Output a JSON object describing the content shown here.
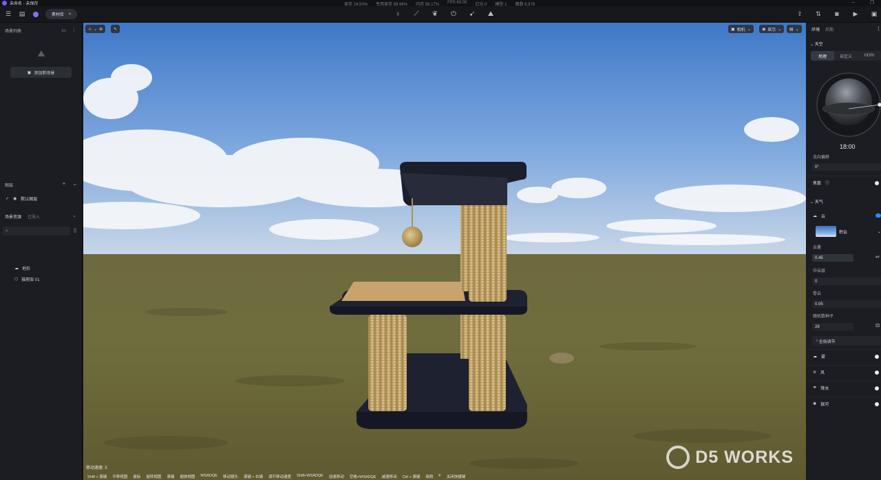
{
  "titlebar": {
    "title": "未命名 - 未保存",
    "stats": [
      "显存 24.50%",
      "专用显存 89.68%",
      "内存 58.17%",
      "FPS 60.00",
      "灯光 0",
      "模型 1",
      "面数 8,976"
    ]
  },
  "toolbar": {
    "library_label": "素材库",
    "center_tools": [
      "light-bulb-icon",
      "path-icon",
      "leaf-icon",
      "power-icon",
      "cursor-icon",
      "terrain-icon"
    ],
    "right_tools": [
      "export-icon",
      "share-icon",
      "camera-icon",
      "video-icon",
      "panel-icon"
    ]
  },
  "left_panel": {
    "scene_list_title": "场景列表",
    "add_scene_label": "添加新场景",
    "layers_title": "图层",
    "default_layer": "默认图层",
    "assets_tab_active": "场景资源",
    "assets_tab_inactive": "已导入",
    "assets": [
      "地形",
      "猫爬架 01"
    ]
  },
  "viewport": {
    "camera_label": "相机",
    "display_label": "显示",
    "status": "移动速度: 5",
    "hints": [
      "Shift + 滚键",
      "平移视图",
      "鼠标",
      "旋转视图",
      "滚键",
      "缩放视图",
      "WSADQE",
      "移动镜头",
      "滚键 + 右键",
      "调节移动速度",
      "Shift+WSADQE",
      "加速移动",
      "空格+WSADQE",
      "减速移动",
      "Ctrl + 滚键",
      "吸附",
      "F",
      "关闭快捷键"
    ],
    "watermark": "D5 WORKS"
  },
  "right_panel": {
    "tab_active": "环境",
    "tab_inactive": "后期",
    "sky_title": "天空",
    "sky_tabs": [
      "地理",
      "自定义",
      "HDRI"
    ],
    "time": "18:00",
    "north_offset_label": "北向偏移",
    "north_offset_value": "0°",
    "focus_label": "焦散",
    "weather_title": "天气",
    "cloud_label": "云",
    "cloud_type": "积云",
    "cloud_amount_label": "云量",
    "cloud_amount_value": "0.45",
    "mid_cloud_label": "中云层",
    "mid_cloud_value": "0",
    "cirrus_label": "卷云",
    "cirrus_value": "0.05",
    "seed_label": "随机数种子",
    "seed_value": "28",
    "global_adjust_label": "全局调节",
    "fog_label": "雾",
    "wind_label": "风",
    "rain_label": "降水",
    "galaxy_label": "银河"
  }
}
